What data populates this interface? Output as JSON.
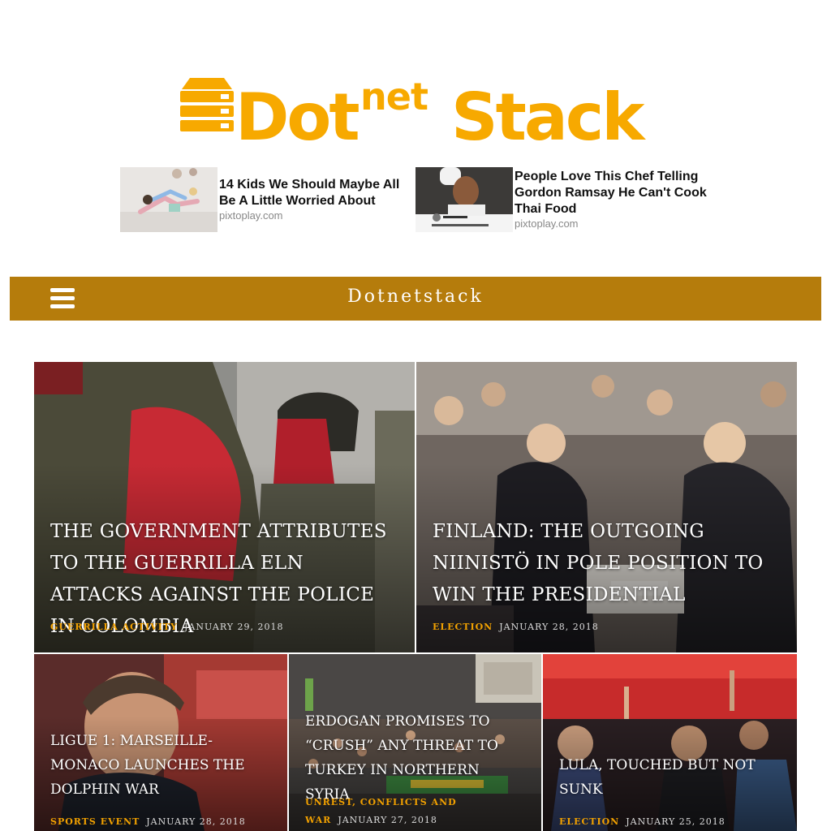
{
  "brand": {
    "logo_parts": {
      "dot": "Dot",
      "net": "net",
      "stack": "Stack"
    },
    "logo_color": "#f7a900",
    "logo_icon": "server-stack-icon"
  },
  "ads": [
    {
      "title": "14 Kids We Should Maybe All Be A Little Worried About",
      "source": "pixtoplay.com"
    },
    {
      "title": "People Love This Chef Telling Gordon Ramsay He Can't Cook Thai Food",
      "source": "pixtoplay.com"
    }
  ],
  "navbar": {
    "title": "Dotnetstack",
    "menu_icon": "hamburger-menu-icon",
    "background": "#b57c0c"
  },
  "articles": [
    {
      "headline": "The Government attributes to the guerrilla ELN attacks against the police in Colombia",
      "category": "Guerrilla Activity",
      "date": "January 29, 2018"
    },
    {
      "headline": "Finland: the outgoing Niinistö in pole position to win the presidential",
      "category": "Election",
      "date": "January 28, 2018"
    },
    {
      "headline": "Ligue 1: Marseille-Monaco launches the dolphin war",
      "category": "Sports Event",
      "date": "January 28, 2018"
    },
    {
      "headline": "Erdogan promises to “crush” any threat to Turkey in northern Syria",
      "category": "Unrest, Conflicts and War",
      "date": "January 27, 2018"
    },
    {
      "headline": "Lula, touched but not sunk",
      "category": "Election",
      "date": "January 25, 2018"
    }
  ],
  "colors": {
    "accent": "#f2a100",
    "nav": "#b57c0c"
  }
}
